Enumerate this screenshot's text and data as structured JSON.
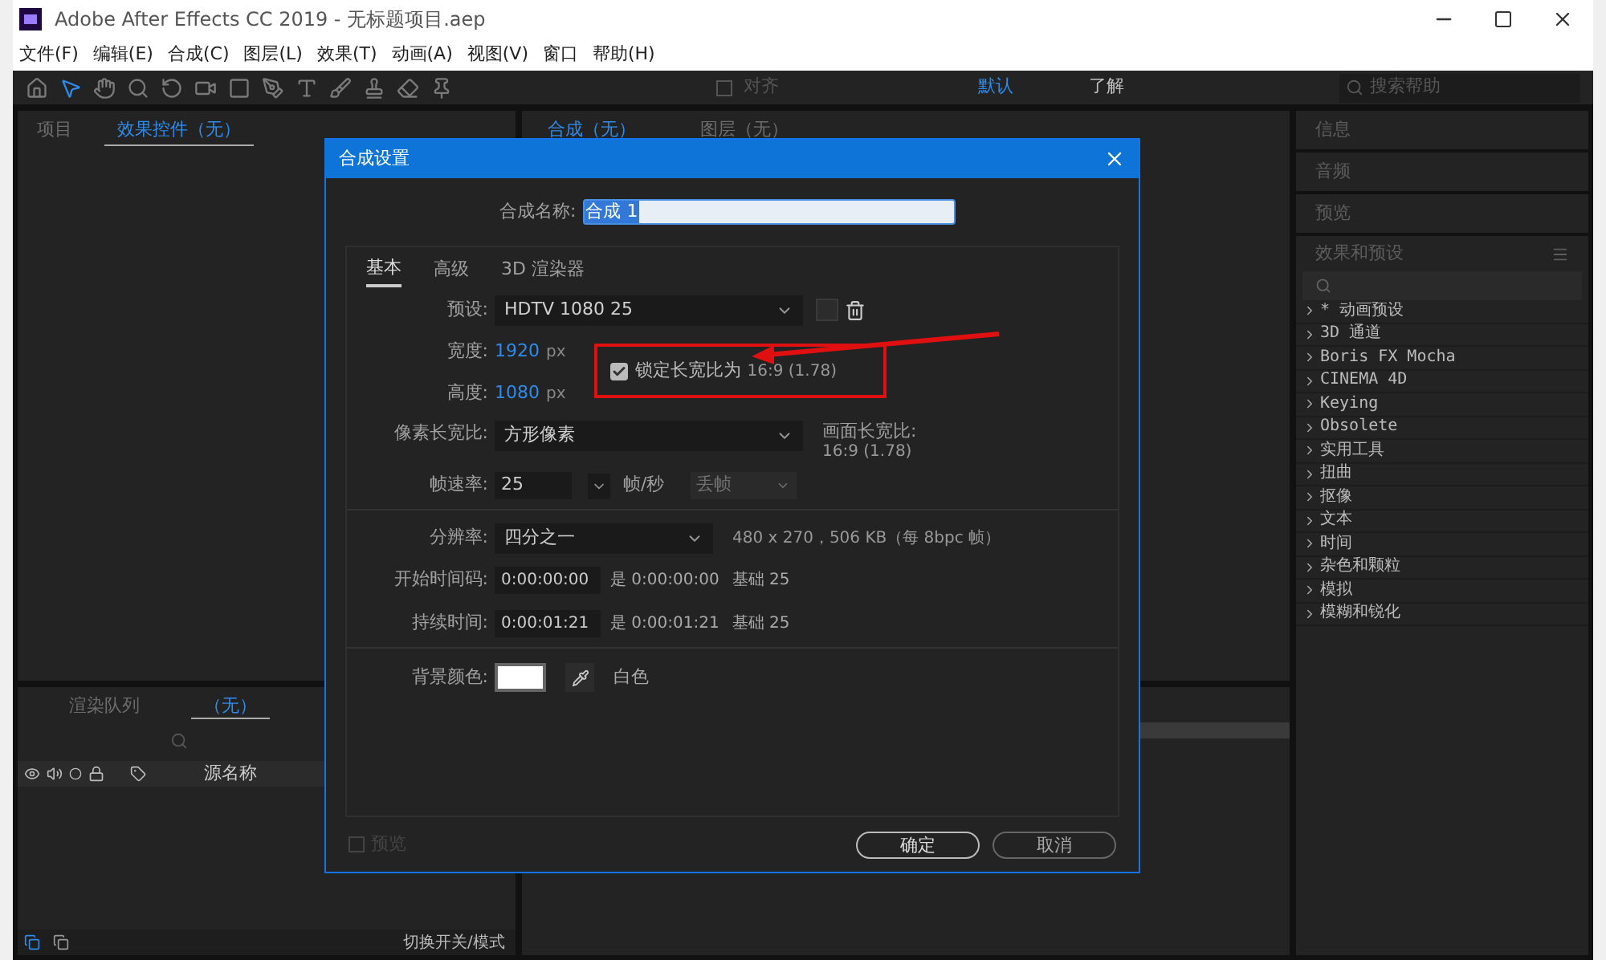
{
  "window": {
    "title": "Adobe After Effects CC 2019 - 无标题项目.aep"
  },
  "menu": [
    "文件(F)",
    "编辑(E)",
    "合成(C)",
    "图层(L)",
    "效果(T)",
    "动画(A)",
    "视图(V)",
    "窗口",
    "帮助(H)"
  ],
  "toolbar": {
    "snap": {
      "label": "对齐",
      "checked": false
    },
    "workspaces": [
      {
        "label": "默认",
        "selected": true
      },
      {
        "label": "了解",
        "selected": false
      }
    ],
    "search": {
      "placeholder": "搜索帮助"
    }
  },
  "left_panel": {
    "tabs": [
      {
        "label": "项目",
        "selected": false
      },
      {
        "label": "效果控件（无）",
        "selected": true
      }
    ]
  },
  "comp_panel": {
    "tabs": [
      {
        "label": "合成（无）",
        "selected": true
      },
      {
        "label": "图层（无）",
        "selected": false
      }
    ]
  },
  "right_panel": {
    "sections": [
      "信息",
      "音频",
      "预览"
    ],
    "effects": {
      "title": "效果和预设",
      "items": [
        "* 动画预设",
        "3D 通道",
        "Boris FX Mocha",
        "CINEMA 4D",
        "Keying",
        "Obsolete",
        "实用工具",
        "扭曲",
        "抠像",
        "文本",
        "时间",
        "杂色和颗粒",
        "模拟",
        "模糊和锐化"
      ]
    }
  },
  "bottom_panel": {
    "tabs": [
      {
        "label": "渲染队列",
        "selected": false
      },
      {
        "label": "（无）",
        "selected": true
      }
    ],
    "column": "源名称",
    "status": "切换开关/模式"
  },
  "dialog": {
    "title": "合成设置",
    "name_label": "合成名称:",
    "name_value": "合成 1",
    "tabs": [
      {
        "label": "基本",
        "selected": true
      },
      {
        "label": "高级",
        "selected": false
      },
      {
        "label": "3D 渲染器",
        "selected": false
      }
    ],
    "preset": {
      "label": "预设:",
      "value": "HDTV 1080 25"
    },
    "width": {
      "label": "宽度:",
      "value": "1920",
      "unit": "px"
    },
    "height": {
      "label": "高度:",
      "value": "1080",
      "unit": "px"
    },
    "lock": {
      "label": "锁定长宽比为",
      "ratio": "16:9 (1.78)",
      "checked": true
    },
    "pixel_aspect": {
      "label": "像素长宽比:",
      "value": "方形像素",
      "frame_label": "画面长宽比:",
      "frame_value": "16:9 (1.78)"
    },
    "frame_rate": {
      "label": "帧速率:",
      "value": "25",
      "unit": "帧/秒",
      "drop": {
        "value": "丢帧",
        "disabled": true
      }
    },
    "resolution": {
      "label": "分辨率:",
      "value": "四分之一",
      "info": "480 x 270，506 KB（每 8bpc 帧）"
    },
    "start": {
      "label": "开始时间码:",
      "value": "0:00:00:00",
      "is": "是 0:00:00:00",
      "base": "基础 25"
    },
    "duration": {
      "label": "持续时间:",
      "value": "0:00:01:21",
      "is": "是 0:00:01:21",
      "base": "基础 25"
    },
    "background": {
      "label": "背景颜色:",
      "color": "#ffffff",
      "name": "白色"
    },
    "preview": {
      "label": "预览",
      "checked": false
    },
    "buttons": [
      "确定",
      "取消"
    ]
  }
}
